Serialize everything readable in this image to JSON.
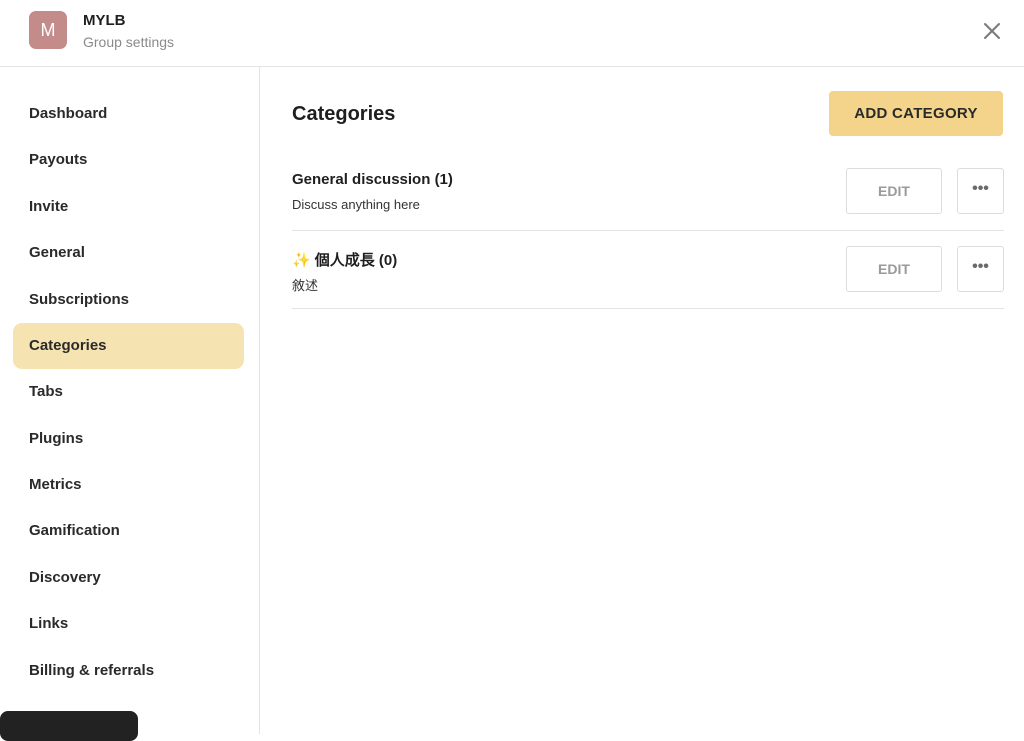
{
  "header": {
    "avatar_letter": "M",
    "group_name": "MYLB",
    "subtitle": "Group settings",
    "close_icon": "close-icon"
  },
  "sidebar": {
    "items": [
      {
        "label": "Dashboard"
      },
      {
        "label": "Payouts"
      },
      {
        "label": "Invite"
      },
      {
        "label": "General"
      },
      {
        "label": "Subscriptions"
      },
      {
        "label": "Categories",
        "active": true
      },
      {
        "label": "Tabs"
      },
      {
        "label": "Plugins"
      },
      {
        "label": "Metrics"
      },
      {
        "label": "Gamification"
      },
      {
        "label": "Discovery"
      },
      {
        "label": "Links"
      },
      {
        "label": "Billing & referrals"
      }
    ]
  },
  "main": {
    "title": "Categories",
    "add_button": "ADD CATEGORY",
    "categories": [
      {
        "emoji": "",
        "name": "General discussion",
        "count": "(1)",
        "description": "Discuss anything here",
        "edit_label": "EDIT",
        "more_icon": "more-icon",
        "more_glyph": "•••"
      },
      {
        "emoji": "✨",
        "name": "個人成長",
        "count": "(0)",
        "description": "敘述",
        "edit_label": "EDIT",
        "more_icon": "more-icon",
        "more_glyph": "•••"
      }
    ]
  },
  "colors": {
    "accent": "#f3d48a",
    "active_nav": "#f6e3b2",
    "avatar": "#c48b8b"
  }
}
